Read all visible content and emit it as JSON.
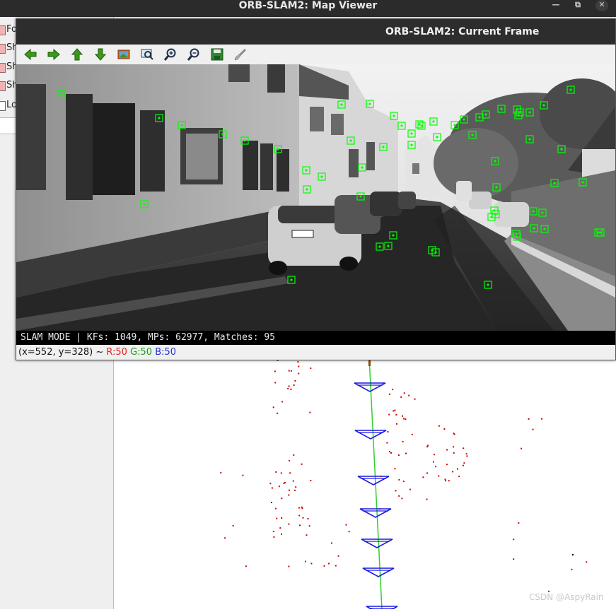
{
  "map_viewer": {
    "title": "ORB-SLAM2: Map Viewer",
    "window_controls": {
      "minimize": "—",
      "maximize": "⧉",
      "close": "✕"
    },
    "panel_items": [
      {
        "label": "Fo",
        "checked": true
      },
      {
        "label": "Sh",
        "checked": true
      },
      {
        "label": "Sh",
        "checked": true
      },
      {
        "label": "Sh",
        "checked": true
      },
      {
        "label": "Lo",
        "checked": false
      }
    ],
    "watermark": "CSDN @AspyRain"
  },
  "current_frame": {
    "title": "ORB-SLAM2: Current Frame",
    "toolbar": [
      "arrow-left-icon",
      "arrow-right-icon",
      "arrow-up-icon",
      "arrow-down-icon",
      "image-icon",
      "zoom-fit-icon",
      "zoom-in-icon",
      "zoom-out-icon",
      "save-icon",
      "brush-icon"
    ],
    "status": "SLAM MODE |  KFs: 1049, MPs: 62977, Matches: 95",
    "pixel_info": {
      "coords": "(x=552, y=328) ~ ",
      "r": "R:50",
      "g": "G:50",
      "b": "B:50"
    }
  },
  "colors": {
    "feature_box": "#00ff00",
    "map_point": "#d00000",
    "keyframe": "#1a1ae0",
    "trajectory": "#30d030"
  }
}
